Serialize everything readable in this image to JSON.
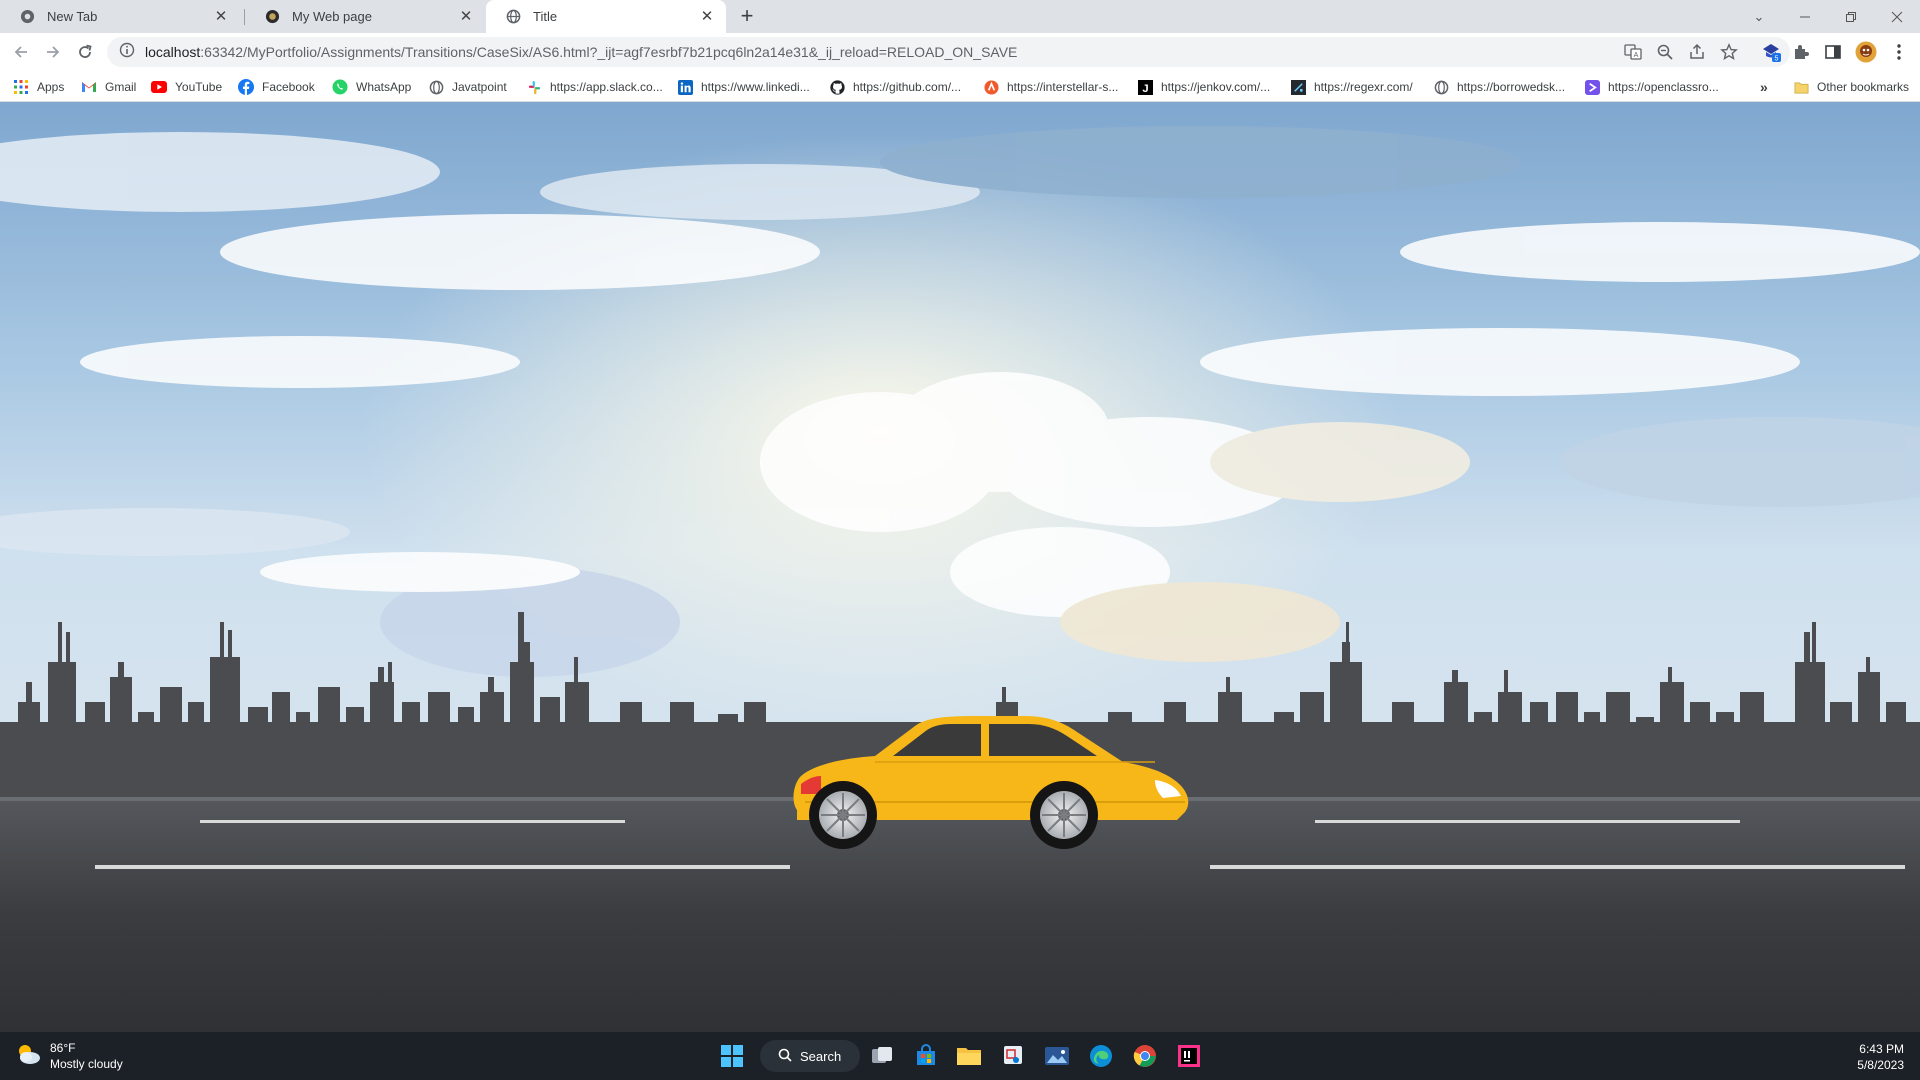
{
  "tabs": [
    {
      "title": "New Tab",
      "icon": "chrome-icon",
      "active": false
    },
    {
      "title": "My Web page",
      "icon": "page-icon",
      "active": false
    },
    {
      "title": "Title",
      "icon": "globe-icon",
      "active": true
    }
  ],
  "address_bar": {
    "host": "localhost",
    "path": ":63342/MyPortfolio/Assignments/Transitions/CaseSix/AS6.html?_ijt=agf7esrbf7b21pcq6ln2a14e31&_ij_reload=RELOAD_ON_SAVE"
  },
  "bookmarks": [
    {
      "label": "Apps",
      "icon": "apps-grid-icon"
    },
    {
      "label": "Gmail",
      "icon": "gmail-icon"
    },
    {
      "label": "YouTube",
      "icon": "youtube-icon"
    },
    {
      "label": "Facebook",
      "icon": "facebook-icon"
    },
    {
      "label": "WhatsApp",
      "icon": "whatsapp-icon"
    },
    {
      "label": "Javatpoint",
      "icon": "globe-icon"
    },
    {
      "label": "https://app.slack.co...",
      "icon": "slack-icon"
    },
    {
      "label": "https://www.linkedi...",
      "icon": "linkedin-icon"
    },
    {
      "label": "https://github.com/...",
      "icon": "github-icon"
    },
    {
      "label": "https://interstellar-s...",
      "icon": "interstellar-icon"
    },
    {
      "label": "https://jenkov.com/...",
      "icon": "jenkov-icon"
    },
    {
      "label": "https://regexr.com/",
      "icon": "regexr-icon"
    },
    {
      "label": "https://borrowedsk...",
      "icon": "globe-icon"
    },
    {
      "label": "https://openclassro...",
      "icon": "openclassrooms-icon"
    }
  ],
  "other_bookmarks_label": "Other bookmarks",
  "taskbar": {
    "weather_temp": "86°F",
    "weather_desc": "Mostly cloudy",
    "search_label": "Search",
    "time": "6:43 PM",
    "date": "5/8/2023"
  },
  "colors": {
    "car_body": "#f7b718",
    "road": "#3d3f42",
    "skyline": "#4a4c50",
    "sky_top": "#6f9bc4",
    "taskbar": "#1c2127"
  }
}
